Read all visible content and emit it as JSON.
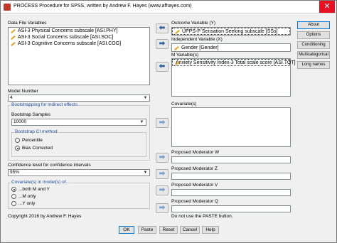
{
  "window": {
    "title": "PROCESS Procedure for SPSS, written by Andrew F. Hayes (www.afhayes.com)",
    "close_glyph": "✕"
  },
  "data_file_variables": {
    "label": "Data File Variables",
    "items": [
      "ASI-3 Physical Concerns subscale [ASI.PHY]",
      "ASI-3 Social Concerns subscale [ASI.SOC]",
      "ASI-3 Cognitive Concerns subscale [ASI.COG]"
    ]
  },
  "outcome": {
    "label": "Outcome Variable (Y)",
    "value": "UPPS-P Sensation Seeking subscale [SSs]"
  },
  "independent": {
    "label": "Independent Variable (X)",
    "value": "Gender [Gender]"
  },
  "mediators": {
    "label": "M Variable(s)",
    "items": [
      "Anxiety Sensitivity Index-3 Total scale score [ASI.TOT]"
    ]
  },
  "covariates": {
    "label": "Covariate(s)"
  },
  "moderators": [
    {
      "label": "Proposed Moderator W"
    },
    {
      "label": "Proposed Moderator Z"
    },
    {
      "label": "Proposed Moderator V"
    },
    {
      "label": "Proposed Moderator Q"
    }
  ],
  "side_buttons": [
    "About",
    "Options",
    "Conditioning",
    "Multicategorical",
    "Long names"
  ],
  "model_number": {
    "label": "Model Number",
    "value": "4"
  },
  "bootstrapping": {
    "title": "Bootstrapping for indirect effects",
    "samples_label": "Bootstrap Samples",
    "samples_value": "10000",
    "ci_title": "Bootstrap CI method",
    "options": [
      "Percentile",
      "Bias Corrected"
    ],
    "selected": "Bias Corrected"
  },
  "confidence": {
    "label": "Confidence level for confidence intervals",
    "value": "95%"
  },
  "covariate_models": {
    "title": "Covariate(s) in model(s) of...",
    "options": [
      "...both M and Y",
      "...M only",
      "...Y only"
    ],
    "selected": "...both M and Y"
  },
  "copyright": "Copyright 2016 by Andrew F. Hayes",
  "paste_note": "Do not use the PASTE button.",
  "bottom_buttons": [
    "OK",
    "Paste",
    "Reset",
    "Cancel",
    "Help"
  ],
  "icons": {
    "arrow_left": "⬅",
    "arrow_right": "➡",
    "dropdown": "▼"
  },
  "colors": {
    "accent": "#0078d7",
    "group_title": "#1f4e9c",
    "close": "#e81123"
  }
}
